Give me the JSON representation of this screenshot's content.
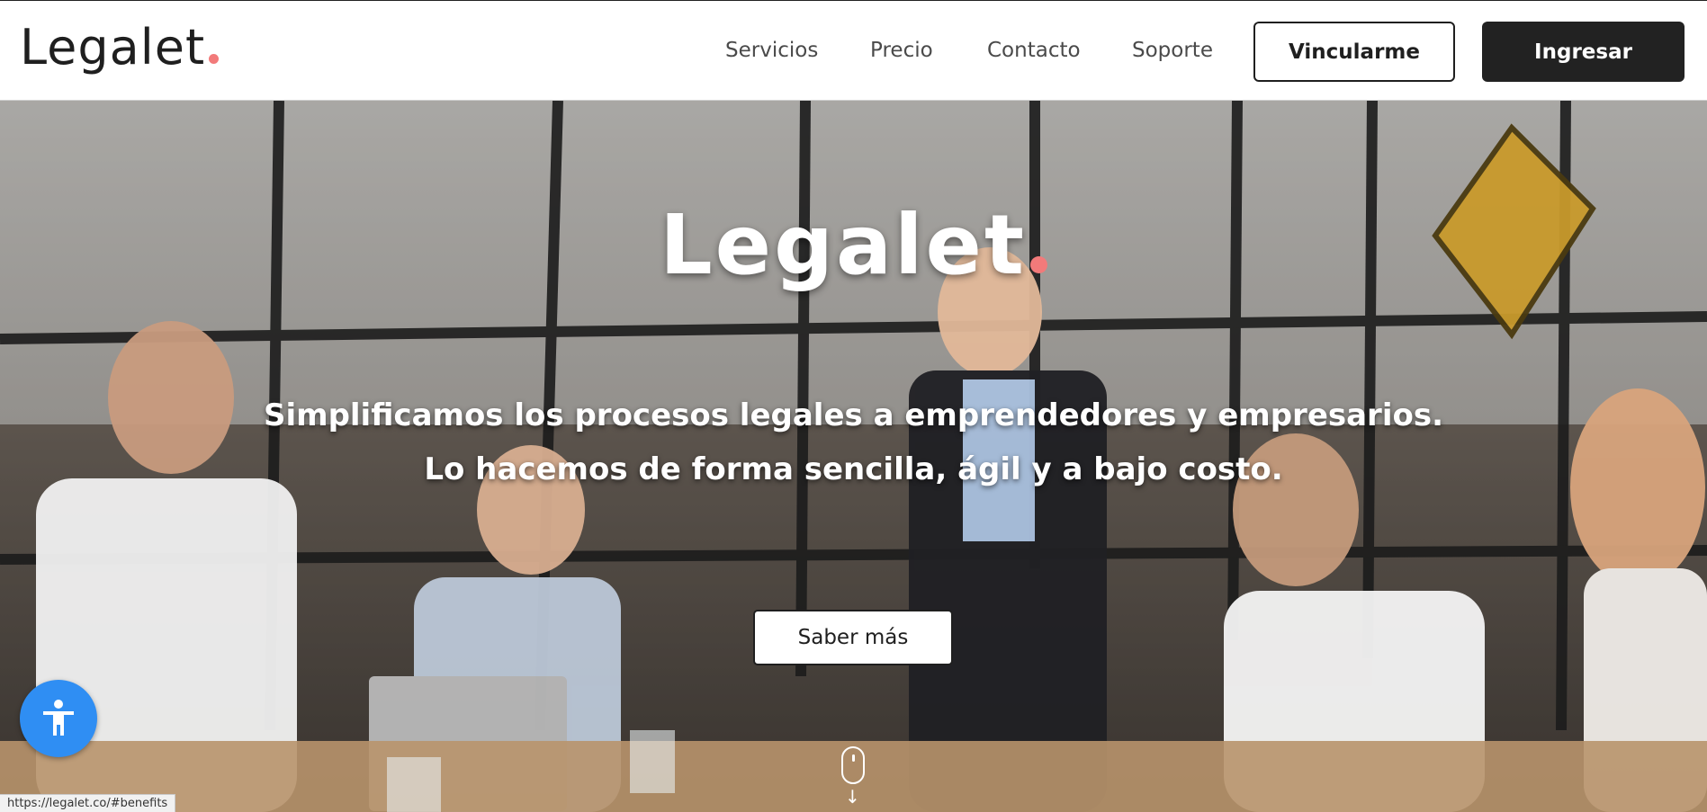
{
  "header": {
    "logo_text": "Legalet",
    "nav": [
      {
        "label": "Servicios"
      },
      {
        "label": "Precio"
      },
      {
        "label": "Contacto"
      },
      {
        "label": "Soporte"
      }
    ],
    "signup_label": "Vincularme",
    "login_label": "Ingresar"
  },
  "hero": {
    "logo_text": "Legalet",
    "tagline_line1": "Simplificamos los procesos legales a emprendedores y empresarios.",
    "tagline_line2": "Lo hacemos de forma sencilla, ágil y a bajo costo.",
    "cta_label": "Saber más"
  },
  "status_bar": {
    "url": "https://legalet.co/#benefits"
  },
  "colors": {
    "brand_dark": "#222222",
    "accent_dot": "#f27a7a",
    "accessibility_blue": "#2f8ef3"
  },
  "icons": {
    "accessibility": "accessibility-person-icon",
    "scroll": "scroll-mouse-icon"
  }
}
